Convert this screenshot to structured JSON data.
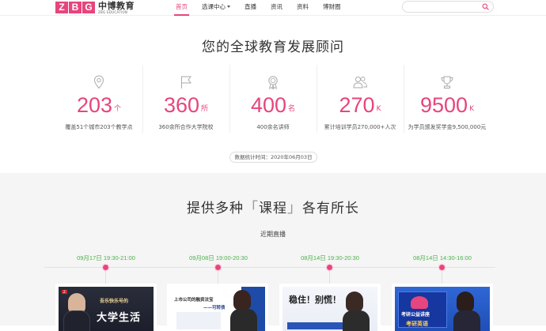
{
  "logo": {
    "letters": [
      "Z",
      "B",
      "G"
    ],
    "cn": "中博教育",
    "en": "ZBG EDUCATION"
  },
  "nav": {
    "items": [
      {
        "label": "首页",
        "active": true
      },
      {
        "label": "选课中心",
        "dropdown": true
      },
      {
        "label": "直播"
      },
      {
        "label": "资讯"
      },
      {
        "label": "资料"
      },
      {
        "label": "博财圈"
      }
    ]
  },
  "search": {
    "placeholder": "",
    "icon": "search-icon"
  },
  "colors": {
    "accent": "#e7457d",
    "time": "#4bb04b"
  },
  "stats": {
    "title": "您的全球教育发展顾问",
    "items": [
      {
        "icon": "location-pin-icon",
        "num": "203",
        "unit": "个",
        "desc": "覆盖51个城市203个教学点"
      },
      {
        "icon": "flag-icon",
        "num": "360",
        "unit": "所",
        "desc": "360余所合作大学院校"
      },
      {
        "icon": "award-medal-icon",
        "num": "400",
        "unit": "名",
        "desc": "400余名讲师"
      },
      {
        "icon": "users-icon",
        "num": "270",
        "unit": "K",
        "desc": "累计培训学员270,000+人次"
      },
      {
        "icon": "trophy-icon",
        "num": "9500",
        "unit": "K",
        "desc": "为学员颁发奖学金9,500,000元"
      }
    ],
    "date_label": "数据统计时间：",
    "date_value": "2020年06月03日"
  },
  "courses": {
    "title_pre": "提供多种",
    "title_key": "课程",
    "title_post": "各有所长",
    "recent_label": "近期直播",
    "live": [
      {
        "time": "09月17日 19:30-21:00",
        "thumb_text": "大学生活",
        "thumb_sub": "吾乐快乐号的"
      },
      {
        "time": "09月08日 19:00-20:30",
        "thumb_text": "上市公司的融资法宝",
        "thumb_sub": "——可转债"
      },
      {
        "time": "08月14日 19:30-20:30",
        "thumb_text": "稳住！别慌！",
        "thumb_sub": ""
      },
      {
        "time": "08月14日 14:30-16:00",
        "thumb_text": "考研公益讲座",
        "thumb_sub": "考研英语"
      }
    ]
  }
}
